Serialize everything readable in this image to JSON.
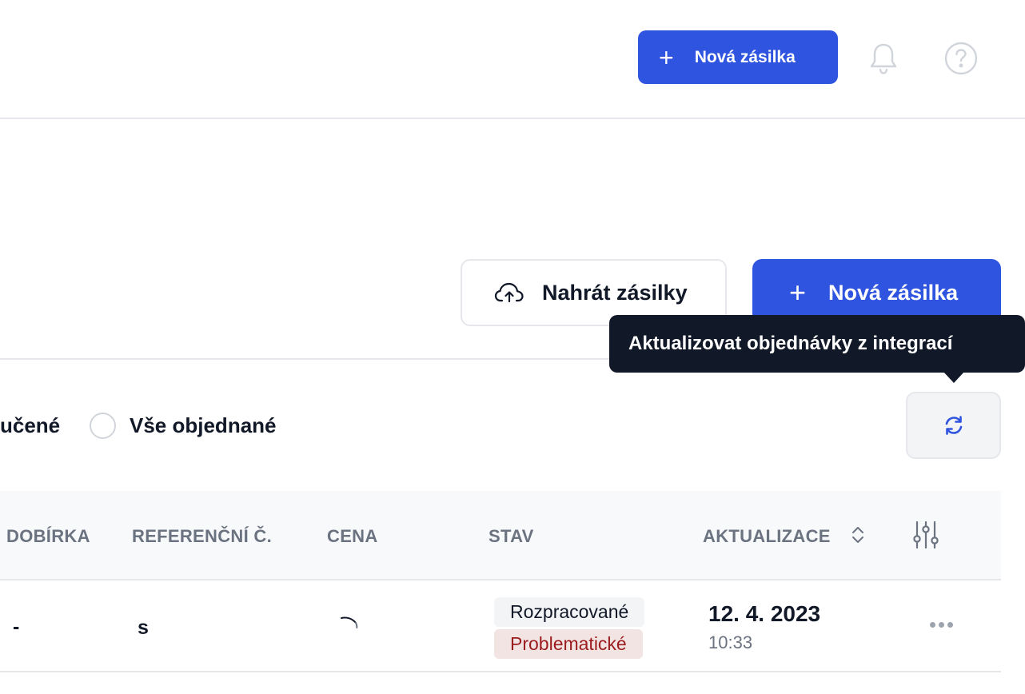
{
  "header": {
    "new_shipment_label": "Nová zásilka",
    "plus_icon": "+",
    "bell_icon": "bell-icon",
    "help_icon": "help-circle-icon"
  },
  "actions": {
    "upload_label": "Nahrát zásilky",
    "upload_icon": "cloud-upload-icon",
    "new_shipment_label": "Nová zásilka"
  },
  "tooltip": {
    "text": "Aktualizovat objednávky z integrací"
  },
  "filters": {
    "prev_partial": "učené",
    "all_ordered": "Vše objednané"
  },
  "table": {
    "headers": {
      "cod": "DOBÍRKA",
      "reference": "REFERENČNÍ Č.",
      "price": "CENA",
      "status": "STAV",
      "updated": "AKTUALIZACE"
    },
    "rows": [
      {
        "cod": "-",
        "reference": "s",
        "price_loading": true,
        "status": [
          "Rozpracované",
          "Problematické"
        ],
        "date": "12. 4. 2023",
        "time": "10:33"
      }
    ]
  },
  "colors": {
    "primary": "#2f54e0",
    "tooltip_bg": "#111827",
    "badge_red_text": "#9b1c1c",
    "badge_red_bg": "#f3e4e4"
  }
}
